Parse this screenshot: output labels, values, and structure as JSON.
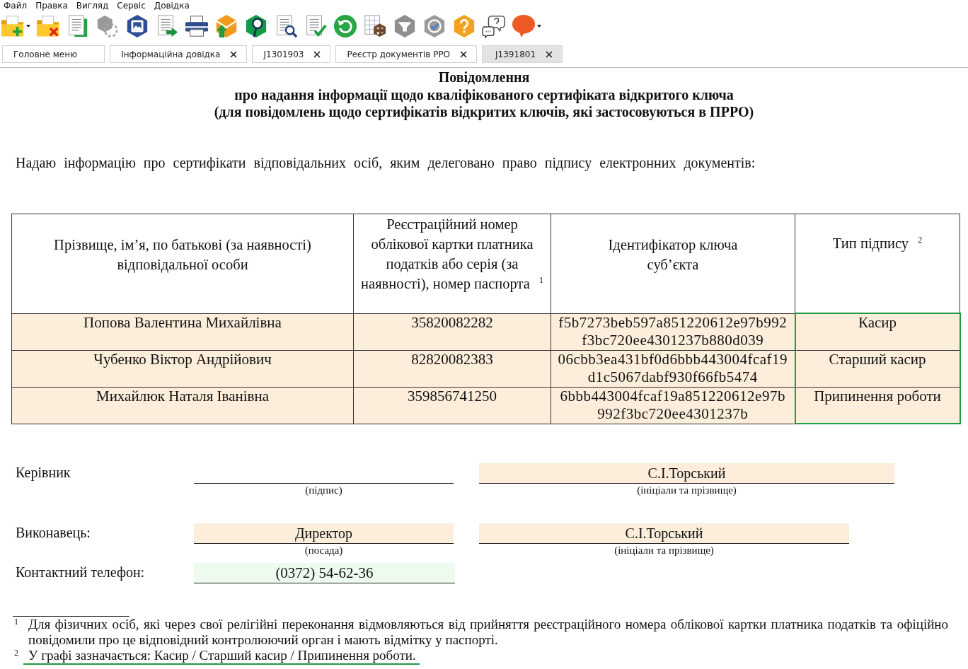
{
  "menu": [
    "Файл",
    "Правка",
    "Вигляд",
    "Сервіс",
    "Довідка"
  ],
  "tabs": [
    {
      "label": "Головне меню",
      "closable": false,
      "selected": false
    },
    {
      "label": "Інформаційна довідка",
      "closable": true,
      "selected": false
    },
    {
      "label": "J1301903",
      "closable": true,
      "selected": false
    },
    {
      "label": "Реєстр документів РРО",
      "closable": true,
      "selected": false
    },
    {
      "label": "J1391801",
      "closable": true,
      "selected": true
    }
  ],
  "document": {
    "title_lines": [
      "Повідомлення",
      "про надання інформації щодо кваліфікованого сертифіката відкритого ключа",
      "(для повідомлень щодо сертифікатів відкритих ключів, які застосовуються в ПРРО)"
    ],
    "intro": "Надаю інформацію про сертифікати відповідальних осіб, яким делеговано право підпису електронних документів:",
    "table": {
      "columns": [
        {
          "label": "Прізвище, ім’я, по батькові (за наявності) відповідальної особи",
          "selected": false
        },
        {
          "label": "Реєстраційний номер облікової картки платника податків або серія (за наявності), номер паспорта $^{1}$",
          "selected": false
        },
        {
          "label": "Ідентифікатор ключа суб’єкта",
          "selected": false
        },
        {
          "label": "Тип підпису $^{2}$",
          "selected": true
        }
      ],
      "rows": [
        [
          "Попова Валентина Михайлівна",
          "35820082282",
          "f5b7273beb597a851220612e97b992f3bc720ee4301237b880d039",
          "Касир"
        ],
        [
          "Чубенко Віктор Андрійович",
          "82820082383",
          "06cbb3ea431bf0d6bbb443004fcaf19d1c5067dabf930f66fb5474",
          "Старший касир"
        ],
        [
          "Михайлюк Наталя Іванівна",
          "359856741250",
          "6bbb443004fcaf19a851220612e97b992f3bc720ee4301237b",
          "Припинення роботи"
        ]
      ]
    },
    "signatures": [
      {
        "label": "Керівник",
        "fields": [
          {
            "kind": "signature",
            "caption": "(підпис)",
            "active": false
          },
          {
            "kind": "text",
            "value": "С.І.Торський",
            "caption": "(ініціали та прізвище)",
            "active": false
          }
        ]
      },
      {
        "label": "Виконавець:",
        "fields": [
          {
            "kind": "text",
            "value": "Директор",
            "caption": "(посада)",
            "active": false
          },
          {
            "kind": "text",
            "value": "С.І.Торський",
            "caption": "(ініціали та прізвище)",
            "active": false
          }
        ]
      },
      {
        "label": "Контактний телефон:",
        "fields": [
          {
            "kind": "text",
            "value": "(0372) 54-62-36",
            "active": true
          }
        ]
      }
    ],
    "footnotes": [
      {
        "mark": "1",
        "text": "Для фізичних осіб, які через свої релігійні переконання відмовляються від прийняття реєстраційного номера облікової картки платника податків та офіційно повідомили про це відповідний контролюючий орган і мають відмітку у паспорті.",
        "highlighted": false
      },
      {
        "mark": "2",
        "text": "У графі зазначається: Касир / Старший касир / Припинення роботи.",
        "highlighted": true
      }
    ]
  }
}
